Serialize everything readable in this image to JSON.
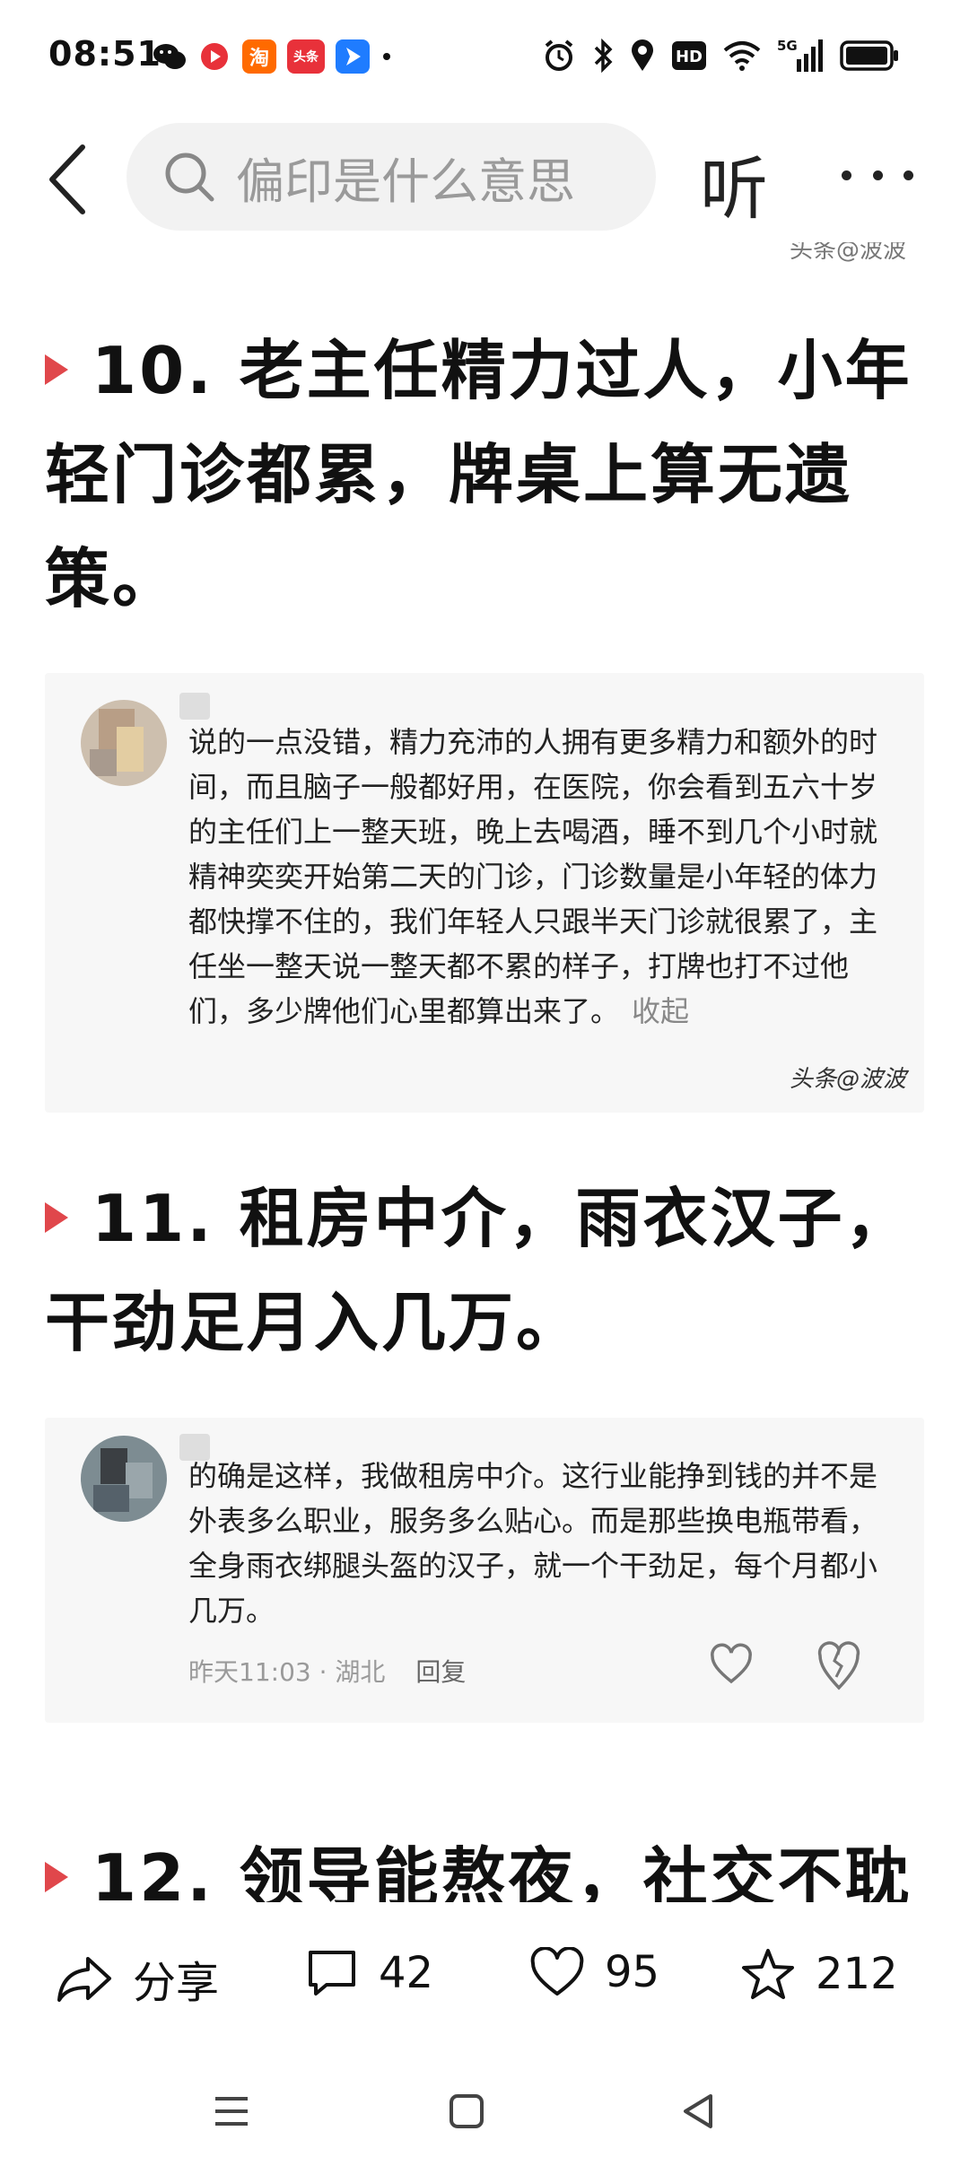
{
  "status_bar": {
    "time": "08:51",
    "notif_icons": [
      {
        "name": "wechat-icon",
        "color": "#111111",
        "glyph": "●"
      },
      {
        "name": "video-app-icon",
        "color": "#e8313a",
        "glyph": "●"
      },
      {
        "name": "taobao-icon",
        "color": "#ff6a00",
        "glyph": "淘"
      },
      {
        "name": "toutiao-icon",
        "color": "#e8313a",
        "glyph": "头条"
      },
      {
        "name": "feishu-icon",
        "color": "#1f7cff",
        "glyph": "▲"
      }
    ],
    "network": "5G",
    "hd_label": "HD"
  },
  "header": {
    "search_placeholder": "偏印是什么意思",
    "listen_label": "听"
  },
  "article": {
    "cut_caption": "头条@波波",
    "sections": [
      {
        "heading": "10. 老主任精力过人，小年轻门诊都累，牌桌上算无遗策。",
        "comment": {
          "text": "说的一点没错，精力充沛的人拥有更多精力和额外的时间，而且脑子一般都好用，在医院，你会看到五六十岁的主任们上一整天班，晚上去喝酒，睡不到几个小时就精神奕奕开始第二天的门诊，门诊数量是小年轻的体力都快撑不住的，我们年轻人只跟半天门诊就很累了，主任坐一整天说一整天都不累的样子，打牌也打不过他们，多少牌他们心里都算出来了。",
          "fold_label": "收起",
          "watermark": "头条@波波"
        }
      },
      {
        "heading": "11. 租房中介，雨衣汉子，干劲足月入几万。",
        "comment": {
          "text": "的确是这样，我做租房中介。这行业能挣到钱的并不是外表多么职业，服务多么贴心。而是那些换电瓶带看，全身雨衣绑腿头盔的汉子，就一个干劲足，每个月都小几万。",
          "time_location": "昨天11:03 · 湖北",
          "reply_label": "回复"
        }
      },
      {
        "heading": "12. 领导能熬夜，社交不耽"
      }
    ]
  },
  "actions": {
    "share_label": "分享",
    "comments_count": "42",
    "likes_count": "95",
    "favorites_count": "212"
  },
  "colors": {
    "accent_red": "#e0474b",
    "card_bg": "#f7f7f7",
    "search_bg": "#f2f2f2"
  }
}
